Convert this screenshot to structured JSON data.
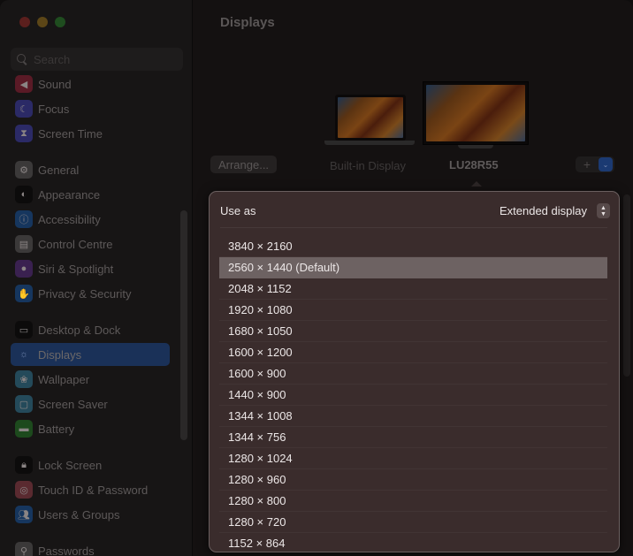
{
  "window": {
    "traffic_lights": [
      "close",
      "minimize",
      "zoom"
    ]
  },
  "sidebar": {
    "search_placeholder": "Search",
    "items": [
      {
        "label": "Sound",
        "icon": "speaker-icon",
        "color": "#5a1a26"
      },
      {
        "label": "Focus",
        "icon": "moon-icon",
        "color": "#2b2a66"
      },
      {
        "label": "Screen Time",
        "icon": "hourglass-icon",
        "color": "#2b2a66"
      },
      {
        "label": "General",
        "icon": "gear-icon",
        "color": "#3b3939"
      },
      {
        "label": "Appearance",
        "icon": "appearance-icon",
        "color": "#0c0b0b"
      },
      {
        "label": "Accessibility",
        "icon": "accessibility-icon",
        "color": "#16365e"
      },
      {
        "label": "Control Centre",
        "icon": "control-centre-icon",
        "color": "#3b3939"
      },
      {
        "label": "Siri & Spotlight",
        "icon": "siri-icon",
        "color": "#3a2150"
      },
      {
        "label": "Privacy & Security",
        "icon": "hand-icon",
        "color": "#16365e"
      },
      {
        "label": "Desktop & Dock",
        "icon": "dock-icon",
        "color": "#0c0b0b"
      },
      {
        "label": "Displays",
        "icon": "sun-icon",
        "color": "#1a3158",
        "active": true
      },
      {
        "label": "Wallpaper",
        "icon": "flower-icon",
        "color": "#244a5a"
      },
      {
        "label": "Screen Saver",
        "icon": "screen-saver-icon",
        "color": "#244a5a"
      },
      {
        "label": "Battery",
        "icon": "battery-icon",
        "color": "#1d4a1d"
      },
      {
        "label": "Lock Screen",
        "icon": "lock-icon",
        "color": "#0c0b0b"
      },
      {
        "label": "Touch ID & Password",
        "icon": "fingerprint-icon",
        "color": "#5a2a30"
      },
      {
        "label": "Users & Groups",
        "icon": "users-icon",
        "color": "#16365e"
      },
      {
        "label": "Passwords",
        "icon": "key-icon",
        "color": "#3b3939"
      }
    ]
  },
  "main": {
    "title": "Displays",
    "arrange_label": "Arrange...",
    "displays": [
      {
        "name": "Built-in Display",
        "selected": false
      },
      {
        "name": "LU28R55",
        "selected": true
      }
    ],
    "add_label": "+",
    "add_menu_icon": "⌄",
    "use_as_label": "Use as",
    "use_as_value": "Extended display",
    "resolutions": [
      {
        "label": "3840 × 2160",
        "selected": false
      },
      {
        "label": "2560 × 1440 (Default)",
        "selected": true
      },
      {
        "label": "2048 × 1152",
        "selected": false
      },
      {
        "label": "1920 × 1080",
        "selected": false
      },
      {
        "label": "1680 × 1050",
        "selected": false
      },
      {
        "label": "1600 × 1200",
        "selected": false
      },
      {
        "label": "1600 × 900",
        "selected": false
      },
      {
        "label": "1440 × 900",
        "selected": false
      },
      {
        "label": "1344 × 1008",
        "selected": false
      },
      {
        "label": "1344 × 756",
        "selected": false
      },
      {
        "label": "1280 × 1024",
        "selected": false
      },
      {
        "label": "1280 × 960",
        "selected": false
      },
      {
        "label": "1280 × 800",
        "selected": false
      },
      {
        "label": "1280 × 720",
        "selected": false
      },
      {
        "label": "1152 × 864",
        "selected": false
      }
    ]
  }
}
